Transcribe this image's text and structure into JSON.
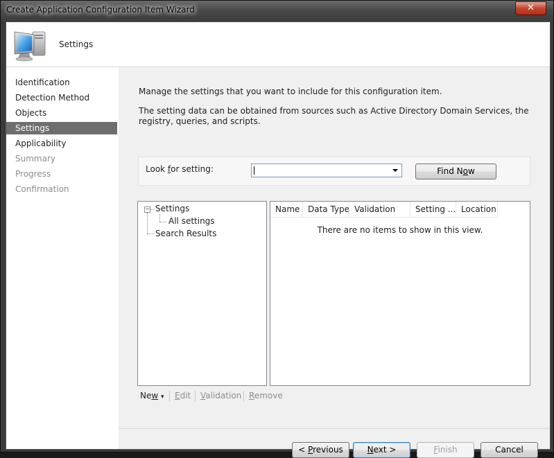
{
  "window": {
    "title": "Create Application Configuration Item Wizard",
    "close_glyph": "✕"
  },
  "header": {
    "icon": "computer-monitor-icon",
    "title": "Settings"
  },
  "nav": {
    "items": [
      {
        "label": "Identification",
        "state": "normal"
      },
      {
        "label": "Detection Method",
        "state": "normal"
      },
      {
        "label": "Objects",
        "state": "normal"
      },
      {
        "label": "Settings",
        "state": "active"
      },
      {
        "label": "Applicability",
        "state": "normal"
      },
      {
        "label": "Summary",
        "state": "disabled"
      },
      {
        "label": "Progress",
        "state": "disabled"
      },
      {
        "label": "Confirmation",
        "state": "disabled"
      }
    ]
  },
  "content": {
    "description_1": "Manage the settings that you want to include for this configuration item.",
    "description_2": "The setting data can be obtained from sources such as Active Directory Domain Services, the registry, queries, and scripts.",
    "lookup": {
      "label_pre": "Look ",
      "label_u": "f",
      "label_post": "or setting:",
      "value": "",
      "find_pre": "Find N",
      "find_u": "o",
      "find_post": "w"
    },
    "tree": {
      "root": "Settings",
      "expander": "−",
      "children": [
        "All settings"
      ],
      "sibling": "Search Results"
    },
    "listview": {
      "columns": [
        "Name",
        "Data Type",
        "Validation",
        "Setting ...",
        "Location"
      ],
      "empty_message": "There are no items to show in this view."
    },
    "toolbar": {
      "new_pre": "Ne",
      "new_u": "w",
      "new_arrow": "▾",
      "edit_u": "E",
      "edit_post": "dit",
      "validation_u": "V",
      "validation_post": "alidation",
      "remove_u": "R",
      "remove_post": "emove"
    }
  },
  "footer": {
    "previous_pre": "< ",
    "previous_u": "P",
    "previous_post": "revious",
    "next_u": "N",
    "next_post": "ext >",
    "finish_u": "F",
    "finish_post": "inish",
    "cancel": "Cancel"
  },
  "colors": {
    "nav_active_bg": "#6e6e6e",
    "content_bg": "#f0f0f0",
    "close_red": "#c7442e"
  }
}
